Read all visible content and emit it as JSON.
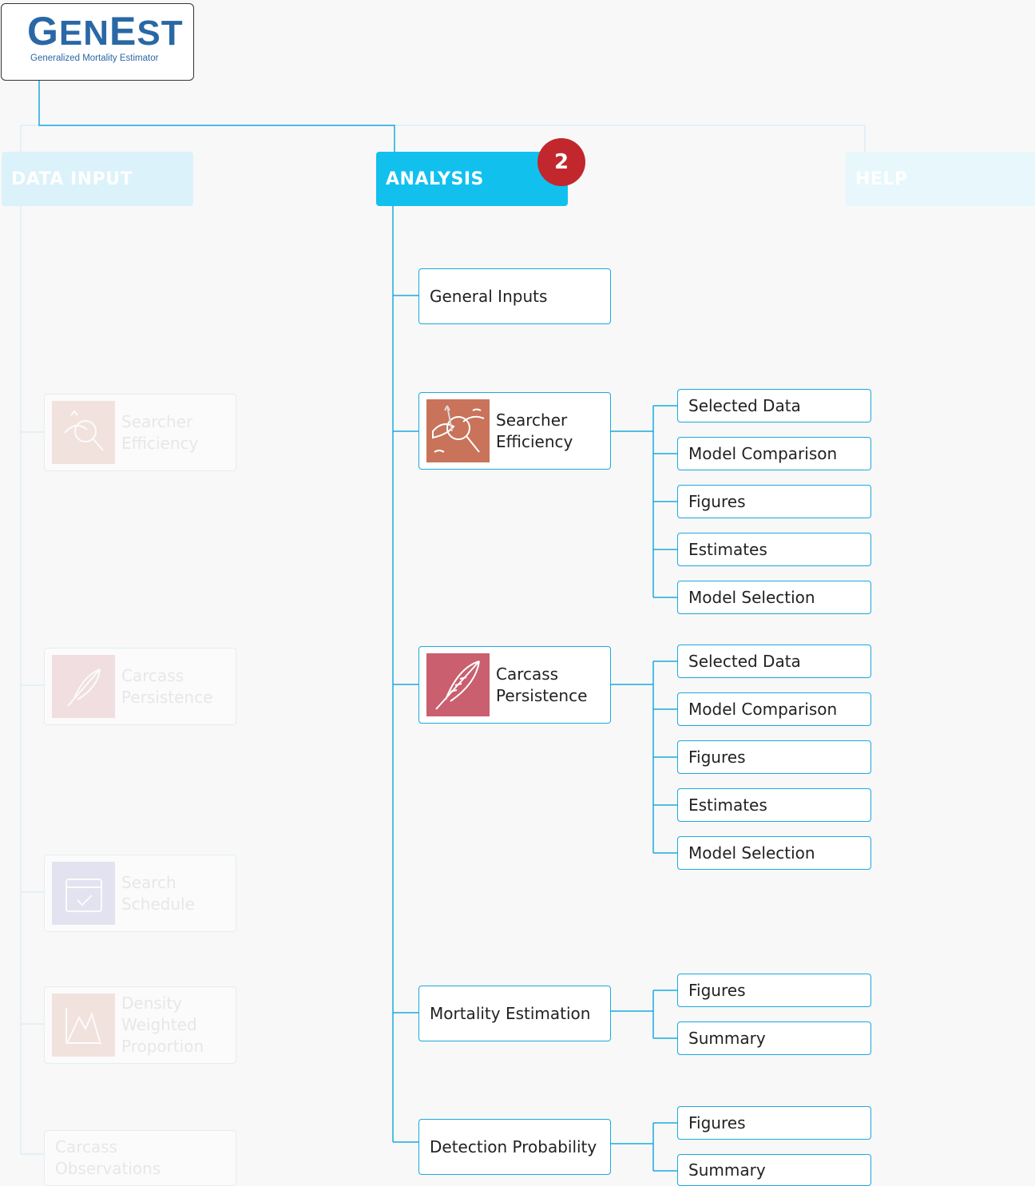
{
  "logo": {
    "title_first": "G",
    "title_rest1": "EN",
    "title_mid": "E",
    "title_rest2": "ST",
    "subtitle": "Generalized Mortality Estimator"
  },
  "tabs": {
    "data_input": "DATA INPUT",
    "analysis": "ANALYSIS",
    "help": "HELP",
    "badge": "2"
  },
  "left": {
    "se": [
      "Searcher",
      "Efficiency"
    ],
    "cp": [
      "Carcass",
      "Persistence"
    ],
    "ss": [
      "Search",
      "Schedule"
    ],
    "dwp": [
      "Density",
      "Weighted",
      "Proportion"
    ],
    "co": [
      "Carcass",
      "Observations"
    ]
  },
  "analysis": {
    "general": "General Inputs",
    "se": [
      "Searcher",
      "Efficiency"
    ],
    "cp": [
      "Carcass",
      "Persistence"
    ],
    "mortality": "Mortality Estimation",
    "detection": "Detection Probability"
  },
  "se_subs": [
    "Selected Data",
    "Model Comparison",
    "Figures",
    "Estimates",
    "Model Selection"
  ],
  "cp_subs": [
    "Selected Data",
    "Model Comparison",
    "Figures",
    "Estimates",
    "Model Selection"
  ],
  "mortality_subs": [
    "Figures",
    "Summary"
  ],
  "detection_subs": [
    "Figures",
    "Summary"
  ],
  "colors": {
    "accent": "#12c0ee",
    "line": "#1aa9e0",
    "badge": "#c1272d",
    "se_icon": "#c8735a",
    "cp_icon": "#c95f6f",
    "logo": "#2a68a5"
  }
}
